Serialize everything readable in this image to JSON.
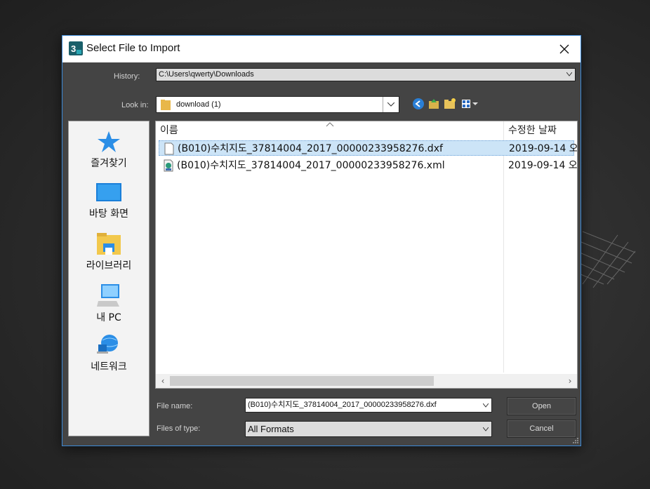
{
  "dialog": {
    "title": "Select File to Import",
    "history_label": "History:",
    "history_value": "C:\\Users\\qwerty\\Downloads",
    "lookin_label": "Look in:",
    "lookin_value": "download (1)",
    "toolbar_icons": [
      "back-icon",
      "up-folder-icon",
      "new-folder-icon",
      "view-menu-icon"
    ]
  },
  "places": [
    {
      "label": "즐겨찾기",
      "icon": "star-icon"
    },
    {
      "label": "바탕 화면",
      "icon": "desktop-icon"
    },
    {
      "label": "라이브러리",
      "icon": "library-icon"
    },
    {
      "label": "내 PC",
      "icon": "computer-icon"
    },
    {
      "label": "네트워크",
      "icon": "network-icon"
    }
  ],
  "file_list": {
    "columns": [
      "이름",
      "수정한 날짜"
    ],
    "rows": [
      {
        "name": "(B010)수치지도_37814004_2017_00000233958276.dxf",
        "date": "2019-09-14 오",
        "icon": "dxf-file-icon",
        "selected": true
      },
      {
        "name": "(B010)수치지도_37814004_2017_00000233958276.xml",
        "date": "2019-09-14 오",
        "icon": "xml-file-icon",
        "selected": false
      }
    ]
  },
  "footer": {
    "filename_label": "File name:",
    "filename_value": "(B010)수치지도_37814004_2017_00000233958276.dxf",
    "filetype_label": "Files of type:",
    "filetype_value": "All Formats",
    "open_label": "Open",
    "cancel_label": "Cancel"
  },
  "colors": {
    "dialog_bg": "#444444",
    "selection": "#cce4f7",
    "border_accent": "#3c8ad8"
  }
}
